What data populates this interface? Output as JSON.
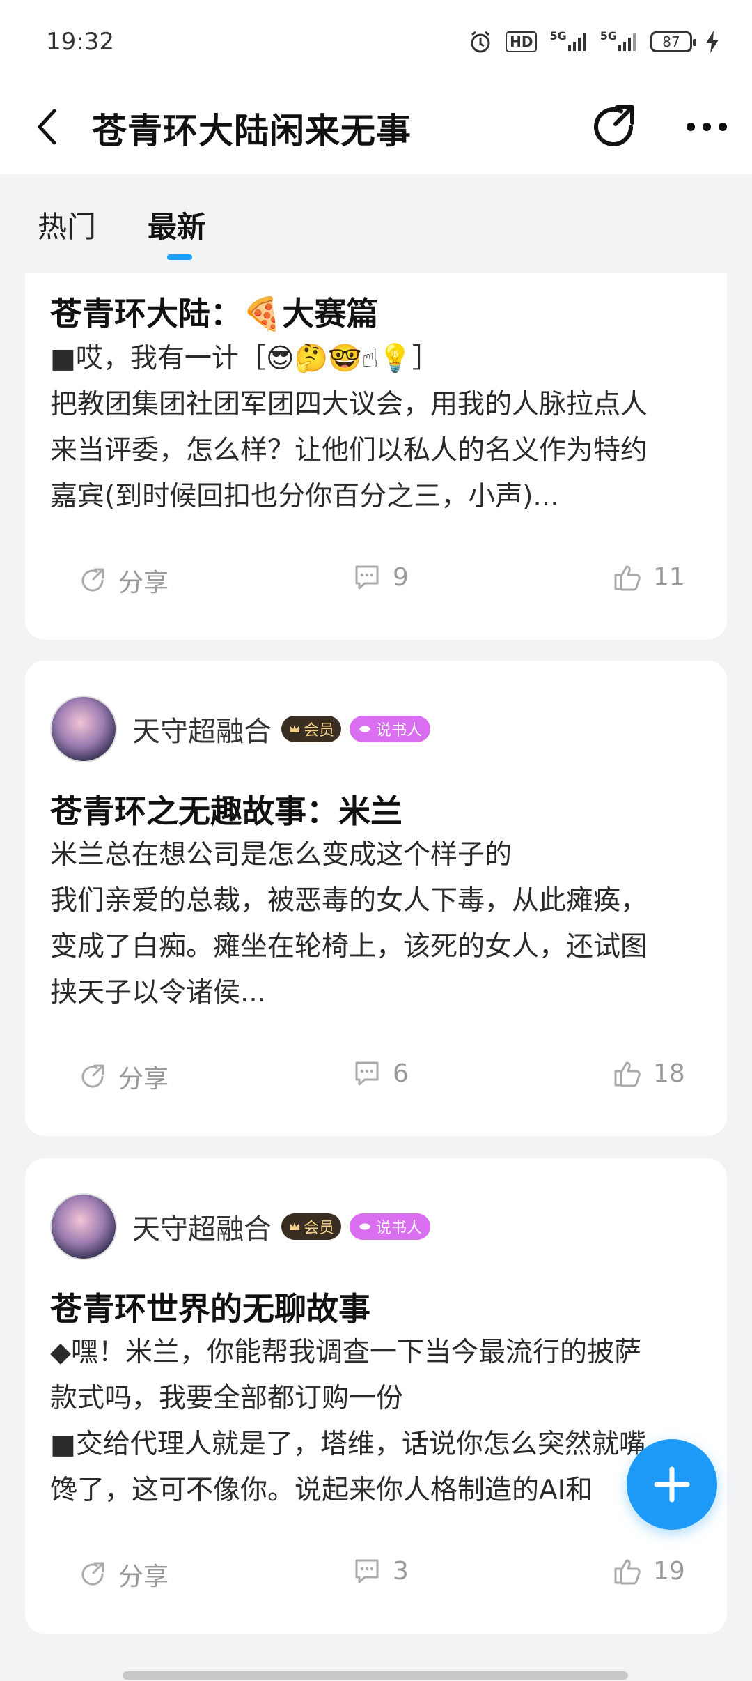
{
  "status_bar": {
    "time": "19:32",
    "hd_label": "HD",
    "signal1_label": "5G",
    "signal2_label": "5G",
    "battery": "87"
  },
  "header": {
    "title": "苍青环大陆闲来无事"
  },
  "tabs": [
    {
      "label": "热门"
    },
    {
      "label": "最新"
    }
  ],
  "posts": [
    {
      "title": "苍青环大陆：🍕大赛篇",
      "body": [
        "■哎，我有一计［😎🤔🤓☝💡］",
        "把教团集团社团军团四大议会，用我的人脉拉点人",
        "来当评委，怎么样？让他们以私人的名义作为特约",
        "嘉宾(到时候回扣也分你百分之三，小声)..."
      ],
      "share_label": "分享",
      "comments": "9",
      "likes": "11"
    },
    {
      "author": "天守超融合",
      "member_badge": "会员",
      "storyteller_badge": "说书人",
      "title": "苍青环之无趣故事：米兰",
      "body": [
        "米兰总在想公司是怎么变成这个样子的",
        "我们亲爱的总裁，被恶毒的女人下毒，从此瘫痪，",
        "变成了白痴。瘫坐在轮椅上，该死的女人，还试图",
        "挟天子以令诸侯..."
      ],
      "share_label": "分享",
      "comments": "6",
      "likes": "18"
    },
    {
      "author": "天守超融合",
      "member_badge": "会员",
      "storyteller_badge": "说书人",
      "title": "苍青环世界的无聊故事",
      "body": [
        "◆嘿！米兰，你能帮我调查一下当今最流行的披萨",
        "款式吗，我要全部都订购一份",
        "■交给代理人就是了，塔维，话说你怎么突然就嘴",
        "馋了，这可不像你。说起来你人格制造的AI和"
      ],
      "share_label": "分享",
      "comments": "3",
      "likes": "19"
    }
  ],
  "colors": {
    "accent": "#1aa0ff",
    "fab": "#1e9bf8",
    "member_badge_bg": "#3a2e22",
    "storyteller_badge_bg": "#d96ef0"
  }
}
